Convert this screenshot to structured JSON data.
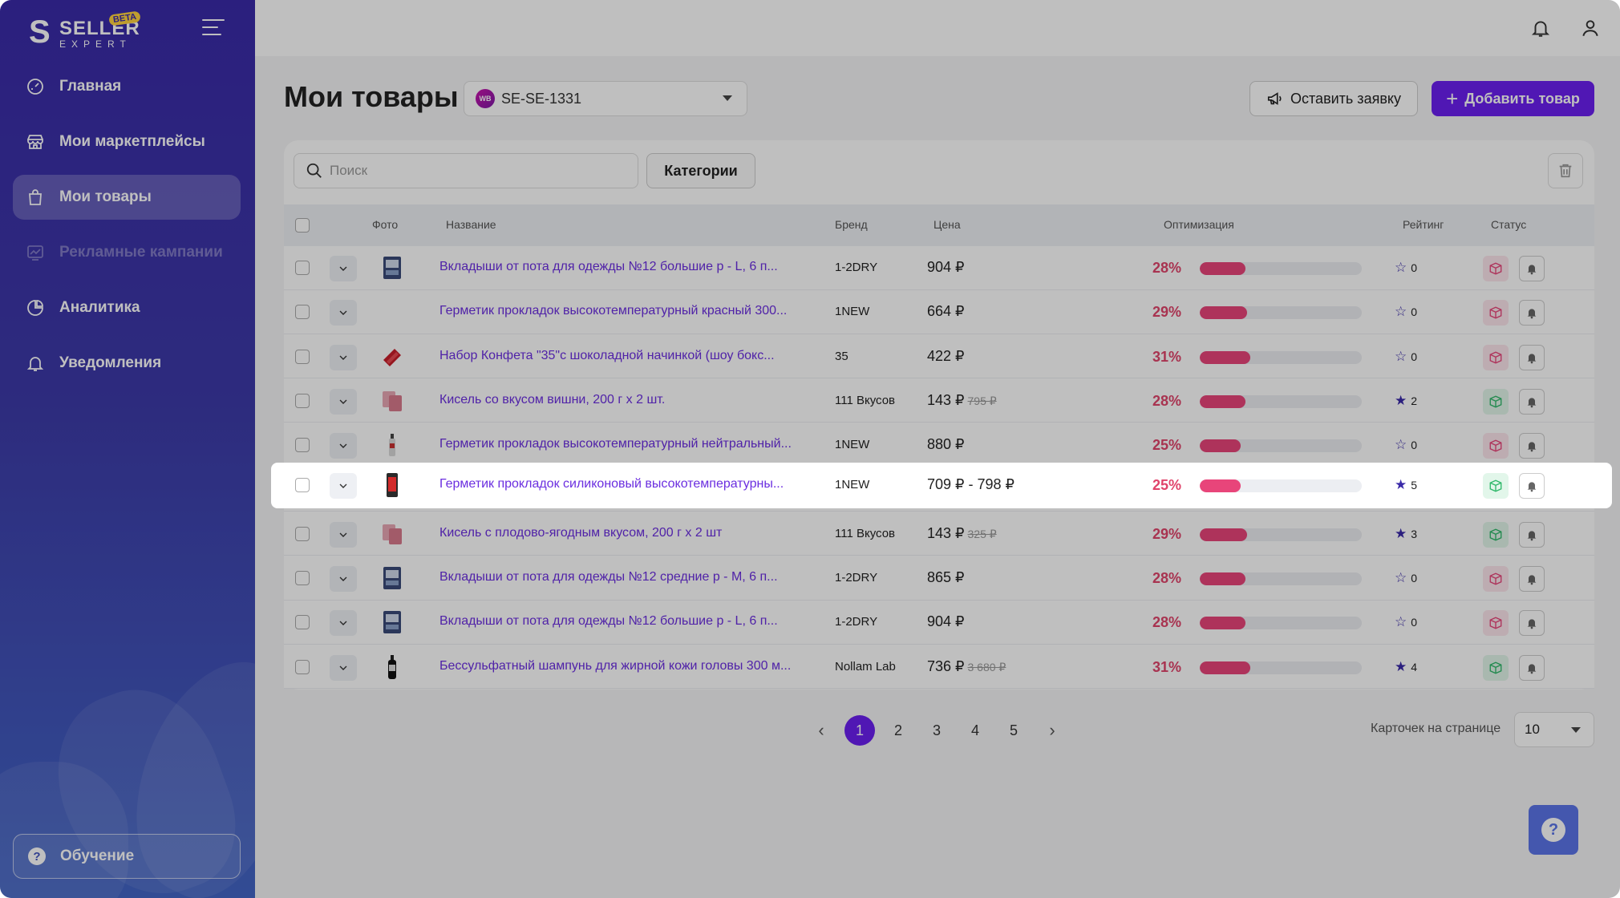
{
  "sidebar": {
    "logo": {
      "letter": "S",
      "line1": "SELLER",
      "line2": "EXPERT",
      "badge": "BETA"
    },
    "items": [
      {
        "label": "Главная",
        "icon": "dashboard-icon",
        "state": "normal"
      },
      {
        "label": "Мои маркетплейсы",
        "icon": "store-icon",
        "state": "normal"
      },
      {
        "label": "Мои товары",
        "icon": "bag-icon",
        "state": "active"
      },
      {
        "label": "Рекламные кампании",
        "icon": "chart-icon",
        "state": "disabled"
      },
      {
        "label": "Аналитика",
        "icon": "pie-chart-icon",
        "state": "normal"
      },
      {
        "label": "Уведомления",
        "icon": "bell-icon",
        "state": "normal"
      }
    ],
    "learn_label": "Обучение"
  },
  "header": {
    "title": "Мои товары",
    "shop": {
      "badge": "WB",
      "value": "SE-SE-1331"
    },
    "request_label": "Оставить заявку",
    "add_label": "Добавить товар"
  },
  "toolbar": {
    "search_placeholder": "Поиск",
    "categories_label": "Категории"
  },
  "table": {
    "columns": [
      "Фото",
      "Название",
      "Бренд",
      "Цена",
      "Оптимизация",
      "Рейтинг",
      "Статус"
    ],
    "rows": [
      {
        "photo": "box-blue",
        "name": "Вкладыши от пота для одежды №12 большие р - L, 6 п...",
        "brand": "1-2DRY",
        "price": "904 ₽",
        "old_price": "",
        "optimization": "28%",
        "opt_value": 0.28,
        "rating": "0",
        "rated": false,
        "status": "off"
      },
      {
        "photo": "none",
        "name": "Герметик прокладок высокотемпературный красный 300...",
        "brand": "1NEW",
        "price": "664 ₽",
        "old_price": "",
        "optimization": "29%",
        "opt_value": 0.29,
        "rating": "0",
        "rated": false,
        "status": "off"
      },
      {
        "photo": "candy-red",
        "name": "Набор Конфета \"35\"с шоколадной начинкой (шоу бокс...",
        "brand": "35",
        "price": "422 ₽",
        "old_price": "",
        "optimization": "31%",
        "opt_value": 0.31,
        "rating": "0",
        "rated": false,
        "status": "off"
      },
      {
        "photo": "pack-pink",
        "name": "Кисель со вкусом вишни, 200 г х 2 шт.",
        "brand": "111 Вкусов",
        "price": "143 ₽",
        "old_price": "795 ₽",
        "optimization": "28%",
        "opt_value": 0.28,
        "rating": "2",
        "rated": true,
        "status": "on"
      },
      {
        "photo": "tube-thin",
        "name": "Герметик прокладок высокотемпературный нейтральный...",
        "brand": "1NEW",
        "price": "880 ₽",
        "old_price": "",
        "optimization": "25%",
        "opt_value": 0.25,
        "rating": "0",
        "rated": false,
        "status": "off"
      },
      {
        "photo": "tube-red",
        "name": "Герметик прокладок силиконовый высокотемпературны...",
        "brand": "1NEW",
        "price": "709 ₽ - 798 ₽",
        "old_price": "",
        "optimization": "25%",
        "opt_value": 0.25,
        "rating": "5",
        "rated": true,
        "status": "on"
      },
      {
        "photo": "pack-pink",
        "name": "Кисель с плодово-ягодным вкусом, 200 г х 2 шт",
        "brand": "111 Вкусов",
        "price": "143 ₽",
        "old_price": "325 ₽",
        "optimization": "29%",
        "opt_value": 0.29,
        "rating": "3",
        "rated": true,
        "status": "on"
      },
      {
        "photo": "box-blue",
        "name": "Вкладыши от пота для одежды №12 средние р - M, 6 п...",
        "brand": "1-2DRY",
        "price": "865 ₽",
        "old_price": "",
        "optimization": "28%",
        "opt_value": 0.28,
        "rating": "0",
        "rated": false,
        "status": "off"
      },
      {
        "photo": "box-blue",
        "name": "Вкладыши от пота для одежды №12 большие р - L, 6 п...",
        "brand": "1-2DRY",
        "price": "904 ₽",
        "old_price": "",
        "optimization": "28%",
        "opt_value": 0.28,
        "rating": "0",
        "rated": false,
        "status": "off"
      },
      {
        "photo": "bottle-black",
        "name": "Бессульфатный шампунь для жирной кожи головы 300 м...",
        "brand": "Nollam Lab",
        "price": "736 ₽",
        "old_price": "3 680 ₽",
        "optimization": "31%",
        "opt_value": 0.31,
        "rating": "4",
        "rated": true,
        "status": "on"
      }
    ],
    "highlighted_row": 5
  },
  "pagination": {
    "pages": [
      "1",
      "2",
      "3",
      "4",
      "5"
    ],
    "current": "1",
    "prev": "‹",
    "next": "›",
    "per_page_label": "Карточек на странице",
    "per_page_value": "10"
  },
  "help_label": "?",
  "colors": {
    "accent": "#6b1ff0",
    "sidebar": "#3a2aa8",
    "optimization": "#e8457a",
    "status_ok": "#2fb86a"
  }
}
